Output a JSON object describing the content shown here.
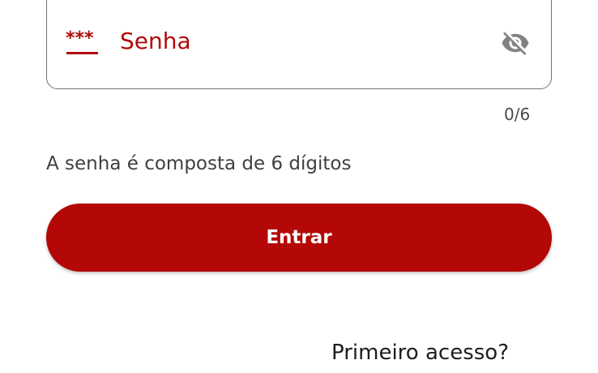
{
  "password_field": {
    "prefix_icon": "masked-password-icon",
    "prefix_text": "***",
    "label": "Senha",
    "visibility_icon": "eye-off-icon",
    "counter": "0/6",
    "accent_color": "#b30a0a",
    "border_color": "#7b6f6a"
  },
  "helper_text": "A senha é composta de 6 dígitos",
  "login_button": {
    "label": "Entrar",
    "background": "#b30807",
    "text_color": "#ffffff"
  },
  "first_access_link": "Primeiro acesso?"
}
